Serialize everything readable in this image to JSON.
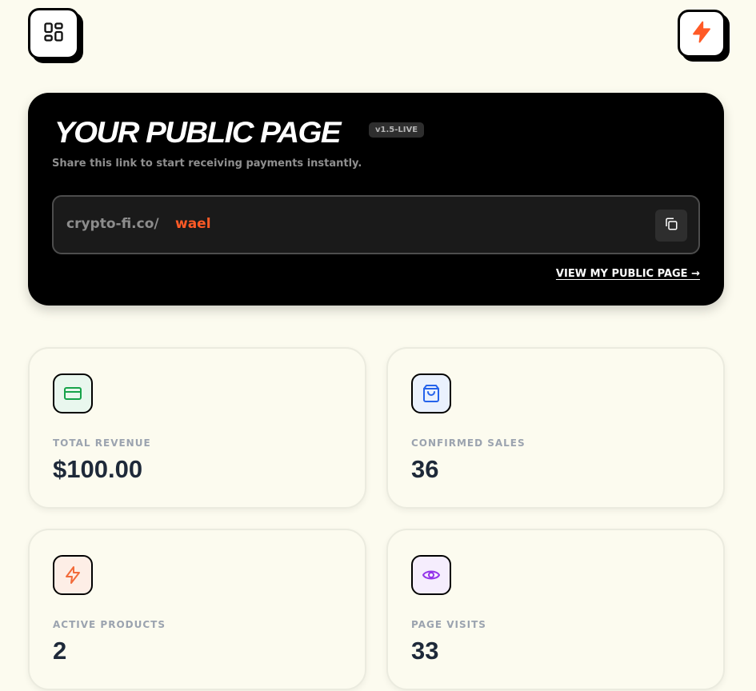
{
  "header": {
    "menu_icon": "grid-icon",
    "action_icon": "bolt-icon"
  },
  "hero": {
    "title": "YOUR PUBLIC PAGE",
    "version_badge": "v1.5-LIVE",
    "subtitle": "Share this link to start receiving payments instantly.",
    "link_prefix": "crypto-fi.co/",
    "link_username": "wael",
    "copy_icon": "copy-icon",
    "view_link": "VIEW MY PUBLIC PAGE →"
  },
  "stats": [
    {
      "label": "TOTAL REVENUE",
      "value": "$100.00",
      "icon": "credit-card-icon",
      "color": "#16a34a"
    },
    {
      "label": "CONFIRMED SALES",
      "value": "36",
      "icon": "shopping-bag-icon",
      "color": "#2563eb"
    },
    {
      "label": "ACTIVE PRODUCTS",
      "value": "2",
      "icon": "bolt-icon",
      "color": "#f26b3a"
    },
    {
      "label": "PAGE VISITS",
      "value": "33",
      "icon": "eye-icon",
      "color": "#9333ea"
    }
  ],
  "colors": {
    "accent": "#ff5a26",
    "background": "#fcfbef",
    "hero_bg": "#000000"
  }
}
